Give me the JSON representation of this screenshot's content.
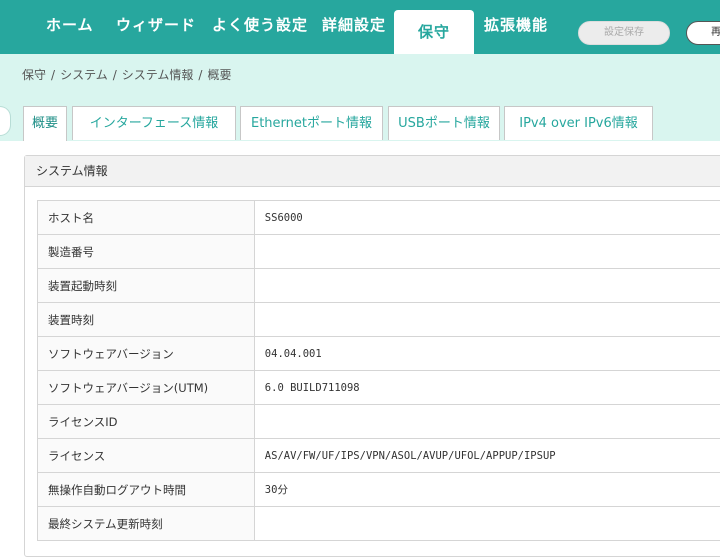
{
  "nav": {
    "items": [
      {
        "label": "ホーム"
      },
      {
        "label": "ウィザード"
      },
      {
        "label": "よく使う設定"
      },
      {
        "label": "詳細設定"
      },
      {
        "label": "保守"
      },
      {
        "label": "拡張機能"
      }
    ],
    "save_label": "設定保存",
    "reboot_label": "再"
  },
  "breadcrumb": [
    "保守",
    "システム",
    "システム情報",
    "概要"
  ],
  "breadcrumb_sep": "/",
  "tabs": [
    {
      "label": "概要"
    },
    {
      "label": "インターフェース情報"
    },
    {
      "label": "Ethernetポート情報"
    },
    {
      "label": "USBポート情報"
    },
    {
      "label": "IPv4 over IPv6情報"
    }
  ],
  "panel": {
    "title": "システム情報",
    "rows": [
      {
        "label": "ホスト名",
        "value": "SS6000"
      },
      {
        "label": "製造番号",
        "value": ""
      },
      {
        "label": "装置起動時刻",
        "value": ""
      },
      {
        "label": "装置時刻",
        "value": ""
      },
      {
        "label": "ソフトウェアバージョン",
        "value": "04.04.001"
      },
      {
        "label": "ソフトウェアバージョン(UTM)",
        "value": "6.0 BUILD711098"
      },
      {
        "label": "ライセンスID",
        "value": ""
      },
      {
        "label": "ライセンス",
        "value": "AS/AV/FW/UF/IPS/VPN/ASOL/AVUP/UFOL/APPUP/IPSUP"
      },
      {
        "label": "無操作自動ログアウト時間",
        "value": "30分"
      },
      {
        "label": "最終システム更新時刻",
        "value": ""
      }
    ]
  },
  "colors": {
    "accent": "#27a79e",
    "band": "#d9f5ef"
  }
}
